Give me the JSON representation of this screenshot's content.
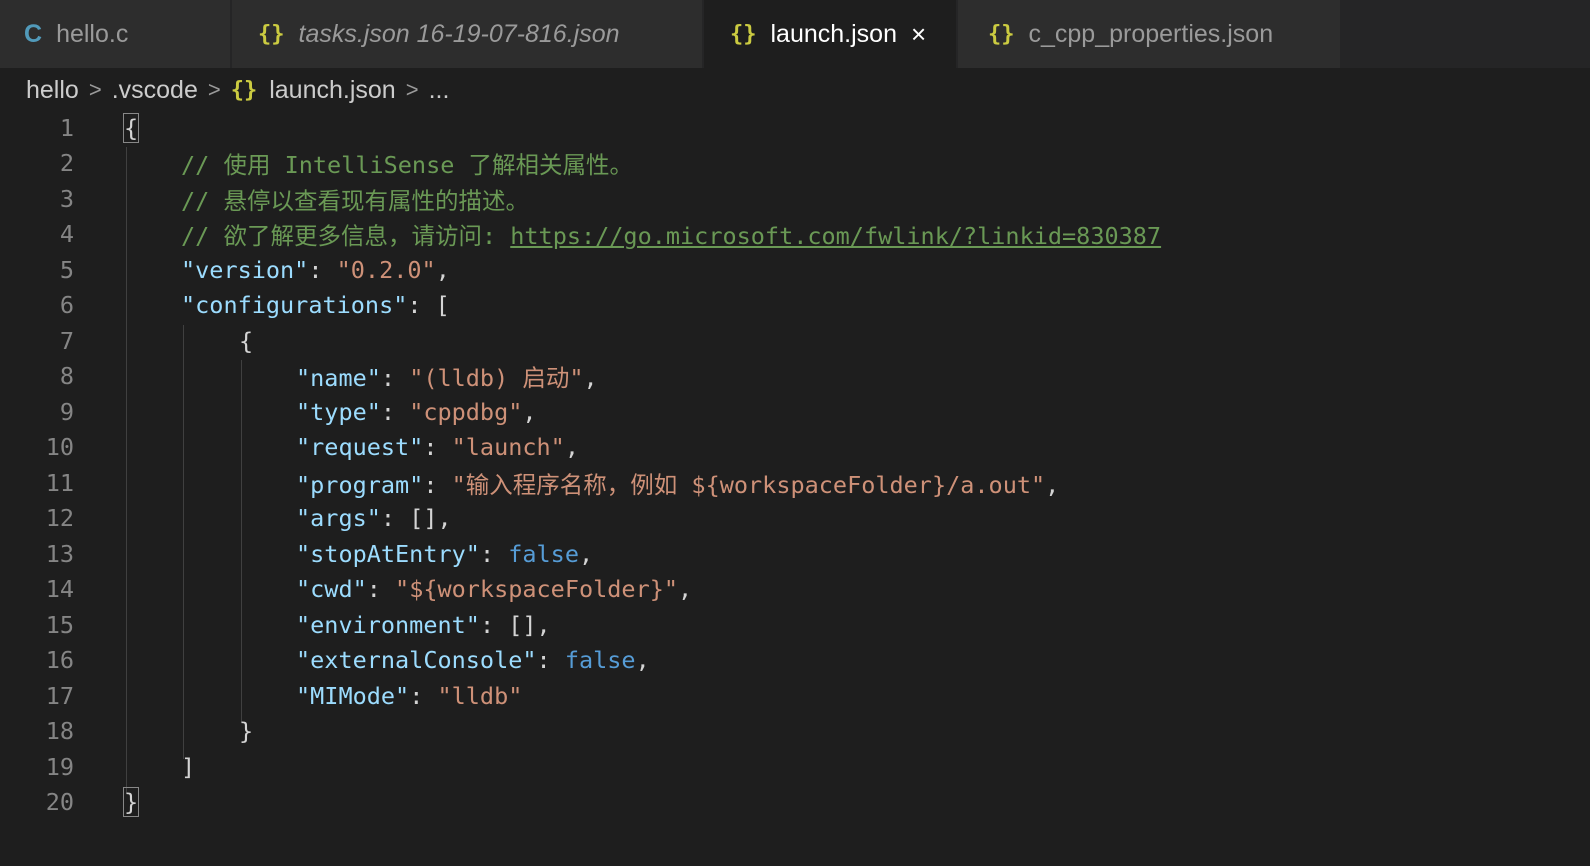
{
  "tabs": [
    {
      "icon": "C",
      "label": "hello.c",
      "italic": false,
      "active": false
    },
    {
      "icon": "{}",
      "label": "tasks.json 16-19-07-816.json",
      "italic": true,
      "active": false
    },
    {
      "icon": "{}",
      "label": "launch.json",
      "italic": false,
      "active": true,
      "close": "×"
    },
    {
      "icon": "{}",
      "label": "c_cpp_properties.json",
      "italic": false,
      "active": false
    }
  ],
  "breadcrumb": {
    "folder": "hello",
    "subfolder": ".vscode",
    "file_icon": "{}",
    "file": "launch.json",
    "more": "..."
  },
  "separator": ">",
  "line_numbers": [
    "1",
    "2",
    "3",
    "4",
    "5",
    "6",
    "7",
    "8",
    "9",
    "10",
    "11",
    "12",
    "13",
    "14",
    "15",
    "16",
    "17",
    "18",
    "19",
    "20"
  ],
  "code": {
    "l1": "{",
    "l2": "// 使用 IntelliSense 了解相关属性。",
    "l3": "// 悬停以查看现有属性的描述。",
    "l4_comment": "// 欲了解更多信息，请访问: ",
    "l4_link": "https://go.microsoft.com/fwlink/?linkid=830387",
    "version_key": "\"version\"",
    "version_val": "\"0.2.0\"",
    "configurations_key": "\"configurations\"",
    "open_array": "[",
    "open_obj": "{",
    "name_key": "\"name\"",
    "name_val": "\"(lldb) 启动\"",
    "type_key": "\"type\"",
    "type_val": "\"cppdbg\"",
    "request_key": "\"request\"",
    "request_val": "\"launch\"",
    "program_key": "\"program\"",
    "program_val": "\"输入程序名称，例如 ${workspaceFolder}/a.out\"",
    "args_key": "\"args\"",
    "args_val": "[]",
    "stopAtEntry_key": "\"stopAtEntry\"",
    "stopAtEntry_val": "false",
    "cwd_key": "\"cwd\"",
    "cwd_val": "\"${workspaceFolder}\"",
    "environment_key": "\"environment\"",
    "environment_val": "[]",
    "externalConsole_key": "\"externalConsole\"",
    "externalConsole_val": "false",
    "MIMode_key": "\"MIMode\"",
    "MIMode_val": "\"lldb\"",
    "close_obj": "}",
    "close_array": "]",
    "l20": "}"
  },
  "punct": {
    "colon": ": ",
    "comma": ","
  },
  "colors": {
    "comment": "#6a9955",
    "key": "#9cdcfe",
    "string": "#ce9178",
    "boolean": "#569cd6",
    "json_icon": "#cbcb41",
    "c_icon": "#519aba"
  }
}
